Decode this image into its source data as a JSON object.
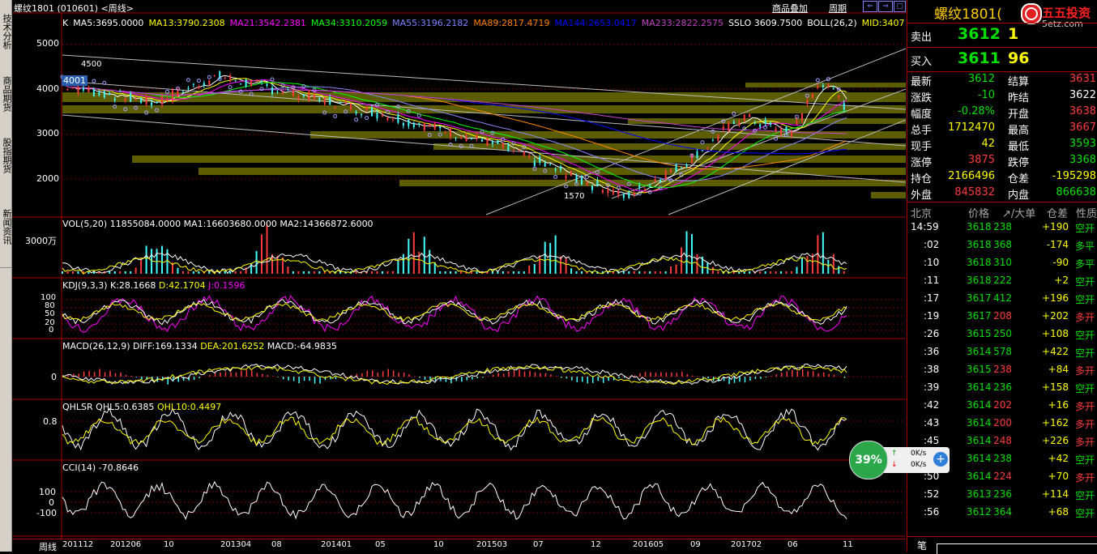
{
  "title_left": "螺纹1801 (010601) <周线>",
  "period_btn_product": "商品叠加",
  "period_btn_cycle": "周期",
  "left_tabs": [
    "技术分析",
    "商品期货",
    "股指期货",
    "新闻资讯"
  ],
  "main": {
    "ma_line": [
      {
        "t": "K",
        "c": "#ffffff"
      },
      {
        "t": "MA5:3695.0000",
        "c": "#ffffff"
      },
      {
        "t": "MA13:3790.2308",
        "c": "#ffff00"
      },
      {
        "t": "MA21:3542.2381",
        "c": "#ff00ff"
      },
      {
        "t": "MA34:3310.2059",
        "c": "#00ff00"
      },
      {
        "t": "MA55:3196.2182",
        "c": "#8080ff"
      },
      {
        "t": "MA89:2817.4719",
        "c": "#ff8000"
      },
      {
        "t": "MA144:2653.0417",
        "c": "#0000ff"
      },
      {
        "t": "MA233:2822.2575",
        "c": "#c040c0"
      },
      {
        "t": "SSLO 3609.7500",
        "c": "#ffffff"
      },
      {
        "t": "BOLL(26,2)",
        "c": "#ffffff"
      },
      {
        "t": "MID:3407",
        "c": "#ffff00"
      }
    ],
    "y_labels": [
      "5000",
      "4000",
      "3000",
      "2000"
    ],
    "tag_left": "4001",
    "tag_high": "4500",
    "tag_low": "1570"
  },
  "vol": {
    "header": "VOL(5,20) 11855084.0000 MA1:16603680.0000 MA2:14366872.6000",
    "y_label": "3000万"
  },
  "kdj": {
    "header_parts": [
      {
        "t": "KDJ(9,3,3) K:28.1668 ",
        "c": "#ffffff"
      },
      {
        "t": "D:42.1704 ",
        "c": "#ffff00"
      },
      {
        "t": "J:0.1596",
        "c": "#ff00ff"
      }
    ],
    "y_labels": [
      "100",
      "80",
      "50",
      "20",
      "0"
    ]
  },
  "macd": {
    "header_parts": [
      {
        "t": "MACD(26,12,9) DIFF:169.1334 ",
        "c": "#ffffff"
      },
      {
        "t": "DEA:201.6252 ",
        "c": "#ffff00"
      },
      {
        "t": "MACD:-64.9835",
        "c": "#ffffff"
      }
    ],
    "y_label": "0"
  },
  "qhlsr": {
    "header_parts": [
      {
        "t": "QHLSR QHL5:0.6385 ",
        "c": "#ffffff"
      },
      {
        "t": "QHL10:0.4497",
        "c": "#ffff00"
      }
    ],
    "y_label": "0.8"
  },
  "cci": {
    "header": "CCI(14) -70.8646",
    "y_labels": [
      "100",
      "0",
      "-100"
    ]
  },
  "x_axis": {
    "label": "周线",
    "ticks": [
      "201112",
      "201206",
      "10",
      "201304",
      "08",
      "201401",
      "05",
      "10",
      "201503",
      "07",
      "12",
      "201605",
      "09",
      "201702",
      "06",
      "11"
    ]
  },
  "right": {
    "title": "螺纹1801",
    "title_suffix": "(",
    "logo_text": "五五投资",
    "logo_url": "5etz.com",
    "sell": {
      "label": "卖出",
      "price": "3612",
      "qty": "1"
    },
    "buy": {
      "label": "买入",
      "price": "3611",
      "qty": "96"
    },
    "quote": [
      {
        "l1": "最新",
        "v1": "3612",
        "c1": "#00e000",
        "l2": "结算",
        "v2": "3631",
        "c2": "#ff3c3c"
      },
      {
        "l1": "涨跌",
        "v1": "-10",
        "c1": "#00e000",
        "l2": "昨结",
        "v2": "3622",
        "c2": "#ffffff"
      },
      {
        "l1": "幅度",
        "v1": "-0.28%",
        "c1": "#00e000",
        "l2": "开盘",
        "v2": "3638",
        "c2": "#ff3c3c"
      },
      {
        "l1": "总手",
        "v1": "1712470",
        "c1": "#ffff00",
        "l2": "最高",
        "v2": "3667",
        "c2": "#ff3c3c"
      },
      {
        "l1": "现手",
        "v1": "42",
        "c1": "#ffff00",
        "l2": "最低",
        "v2": "3593",
        "c2": "#00e000"
      },
      {
        "l1": "涨停",
        "v1": "3875",
        "c1": "#ff3c3c",
        "l2": "跌停",
        "v2": "3368",
        "c2": "#00e000"
      },
      {
        "l1": "持仓",
        "v1": "2166496",
        "c1": "#ffff00",
        "l2": "仓差",
        "v2": "-195298",
        "c2": "#ffff00"
      },
      {
        "l1": "外盘",
        "v1": "845832",
        "c1": "#ff3c3c",
        "l2": "内盘",
        "v2": "866638",
        "c2": "#00e000"
      }
    ],
    "tick_header": {
      "city": "北京",
      "price": "价格",
      "vol": "↗/大单",
      "oi": "仓差",
      "nature": "性质"
    },
    "ticks": [
      {
        "t": "14:59",
        "p": "3618",
        "pc": "#00e000",
        "v": "238",
        "vc": "#00e000",
        "o": "+190",
        "n": "空开",
        "nc": "#00e000"
      },
      {
        "t": ":02",
        "p": "3618",
        "pc": "#00e000",
        "v": "368",
        "vc": "#00e000",
        "o": "-174",
        "n": "多平",
        "nc": "#00e000"
      },
      {
        "t": ":10",
        "p": "3618",
        "pc": "#00e000",
        "v": "310",
        "vc": "#00e000",
        "o": "-90",
        "n": "多平",
        "nc": "#00e000"
      },
      {
        "t": ":11",
        "p": "3618",
        "pc": "#00e000",
        "v": "222",
        "vc": "#00e000",
        "o": "+2",
        "n": "空开",
        "nc": "#00e000"
      },
      {
        "t": ":17",
        "p": "3617",
        "pc": "#00e000",
        "v": "412",
        "vc": "#00e000",
        "o": "+196",
        "n": "空开",
        "nc": "#00e000"
      },
      {
        "t": ":19",
        "p": "3617",
        "pc": "#00e000",
        "v": "208",
        "vc": "#ff3c3c",
        "o": "+202",
        "n": "多开",
        "nc": "#ff3c3c"
      },
      {
        "t": ":26",
        "p": "3615",
        "pc": "#00e000",
        "v": "250",
        "vc": "#00e000",
        "o": "+108",
        "n": "空开",
        "nc": "#00e000"
      },
      {
        "t": ":36",
        "p": "3614",
        "pc": "#00e000",
        "v": "578",
        "vc": "#00e000",
        "o": "+422",
        "n": "空开",
        "nc": "#00e000"
      },
      {
        "t": ":38",
        "p": "3615",
        "pc": "#00e000",
        "v": "238",
        "vc": "#ff3c3c",
        "o": "+84",
        "n": "多开",
        "nc": "#ff3c3c"
      },
      {
        "t": ":39",
        "p": "3614",
        "pc": "#00e000",
        "v": "236",
        "vc": "#00e000",
        "o": "+158",
        "n": "空开",
        "nc": "#00e000"
      },
      {
        "t": ":42",
        "p": "3614",
        "pc": "#00e000",
        "v": "202",
        "vc": "#ff3c3c",
        "o": "+16",
        "n": "多开",
        "nc": "#ff3c3c"
      },
      {
        "t": ":43",
        "p": "3614",
        "pc": "#00e000",
        "v": "200",
        "vc": "#ff3c3c",
        "o": "+162",
        "n": "多开",
        "nc": "#ff3c3c"
      },
      {
        "t": ":45",
        "p": "3614",
        "pc": "#00e000",
        "v": "248",
        "vc": "#ff3c3c",
        "o": "+226",
        "n": "多开",
        "nc": "#ff3c3c"
      },
      {
        "t": ":49",
        "p": "3614",
        "pc": "#00e000",
        "v": "238",
        "vc": "#00e000",
        "o": "+42",
        "n": "空开",
        "nc": "#00e000"
      },
      {
        "t": ":50",
        "p": "3614",
        "pc": "#00e000",
        "v": "224",
        "vc": "#ff3c3c",
        "o": "+70",
        "n": "多开",
        "nc": "#ff3c3c"
      },
      {
        "t": ":52",
        "p": "3613",
        "pc": "#00e000",
        "v": "236",
        "vc": "#00e000",
        "o": "+114",
        "n": "空开",
        "nc": "#00e000"
      },
      {
        "t": ":56",
        "p": "3612",
        "pc": "#00e000",
        "v": "364",
        "vc": "#00e000",
        "o": "+68",
        "n": "空开",
        "nc": "#00e000"
      }
    ],
    "bottom_tab": "笔"
  },
  "speed": {
    "percent": "39%",
    "up": "0K/s",
    "down": "0K/s"
  }
}
